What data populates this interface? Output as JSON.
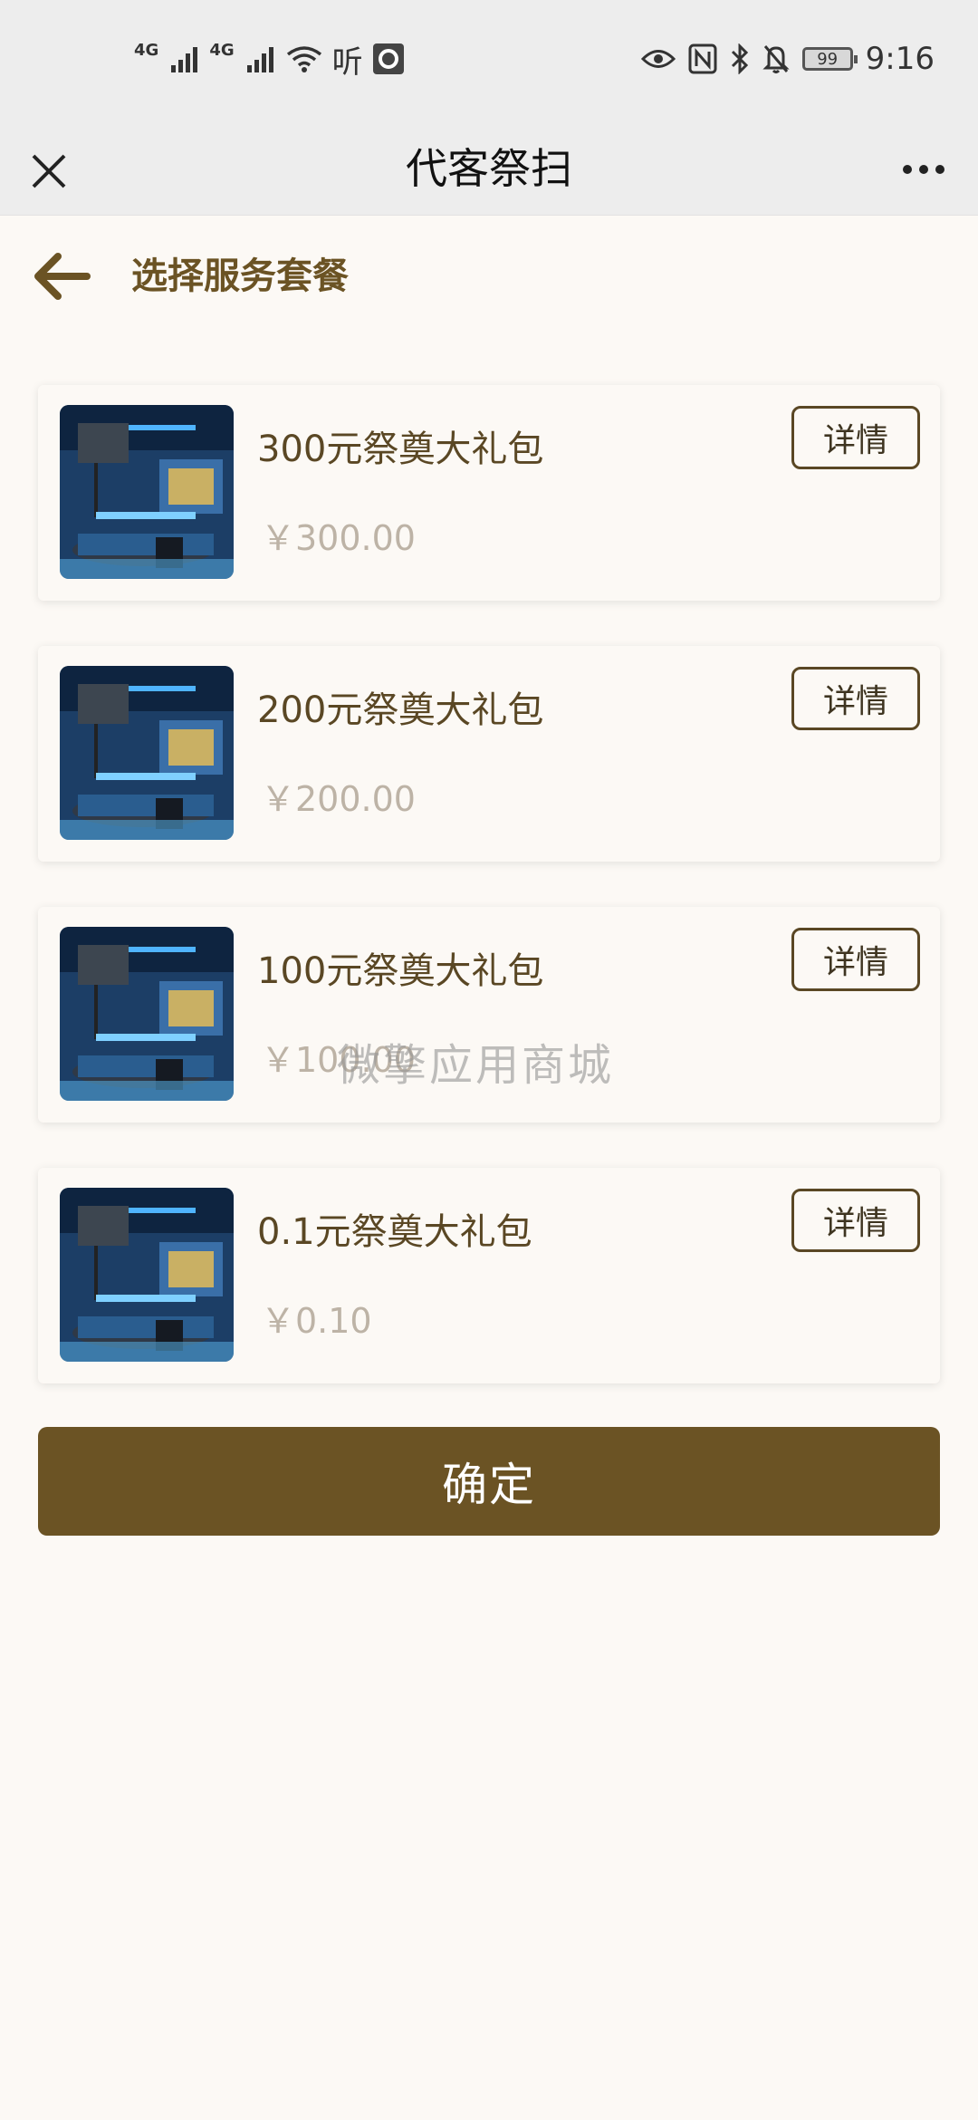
{
  "status_bar": {
    "network_1": "4G",
    "network_2": "4G",
    "hd_label": "听",
    "battery": "99",
    "time": "9:16"
  },
  "header": {
    "title": "代客祭扫",
    "close_icon": "close-icon",
    "more_icon": "more-dots-icon"
  },
  "section": {
    "title": "选择服务套餐",
    "back_icon": "arrow-left-icon"
  },
  "packages": [
    {
      "name": "300元祭奠大礼包",
      "price": "￥300.00",
      "detail_label": "详情"
    },
    {
      "name": "200元祭奠大礼包",
      "price": "￥200.00",
      "detail_label": "详情"
    },
    {
      "name": "100元祭奠大礼包",
      "price": "￥100.00",
      "detail_label": "详情"
    },
    {
      "name": "0.1元祭奠大礼包",
      "price": "￥0.10",
      "detail_label": "详情"
    }
  ],
  "watermark": "微擎应用商城",
  "confirm_label": "确定",
  "colors": {
    "accent": "#6b5324",
    "background": "#fcf9f5",
    "header_bg": "#ededed",
    "price_text": "#bdb3a6"
  }
}
